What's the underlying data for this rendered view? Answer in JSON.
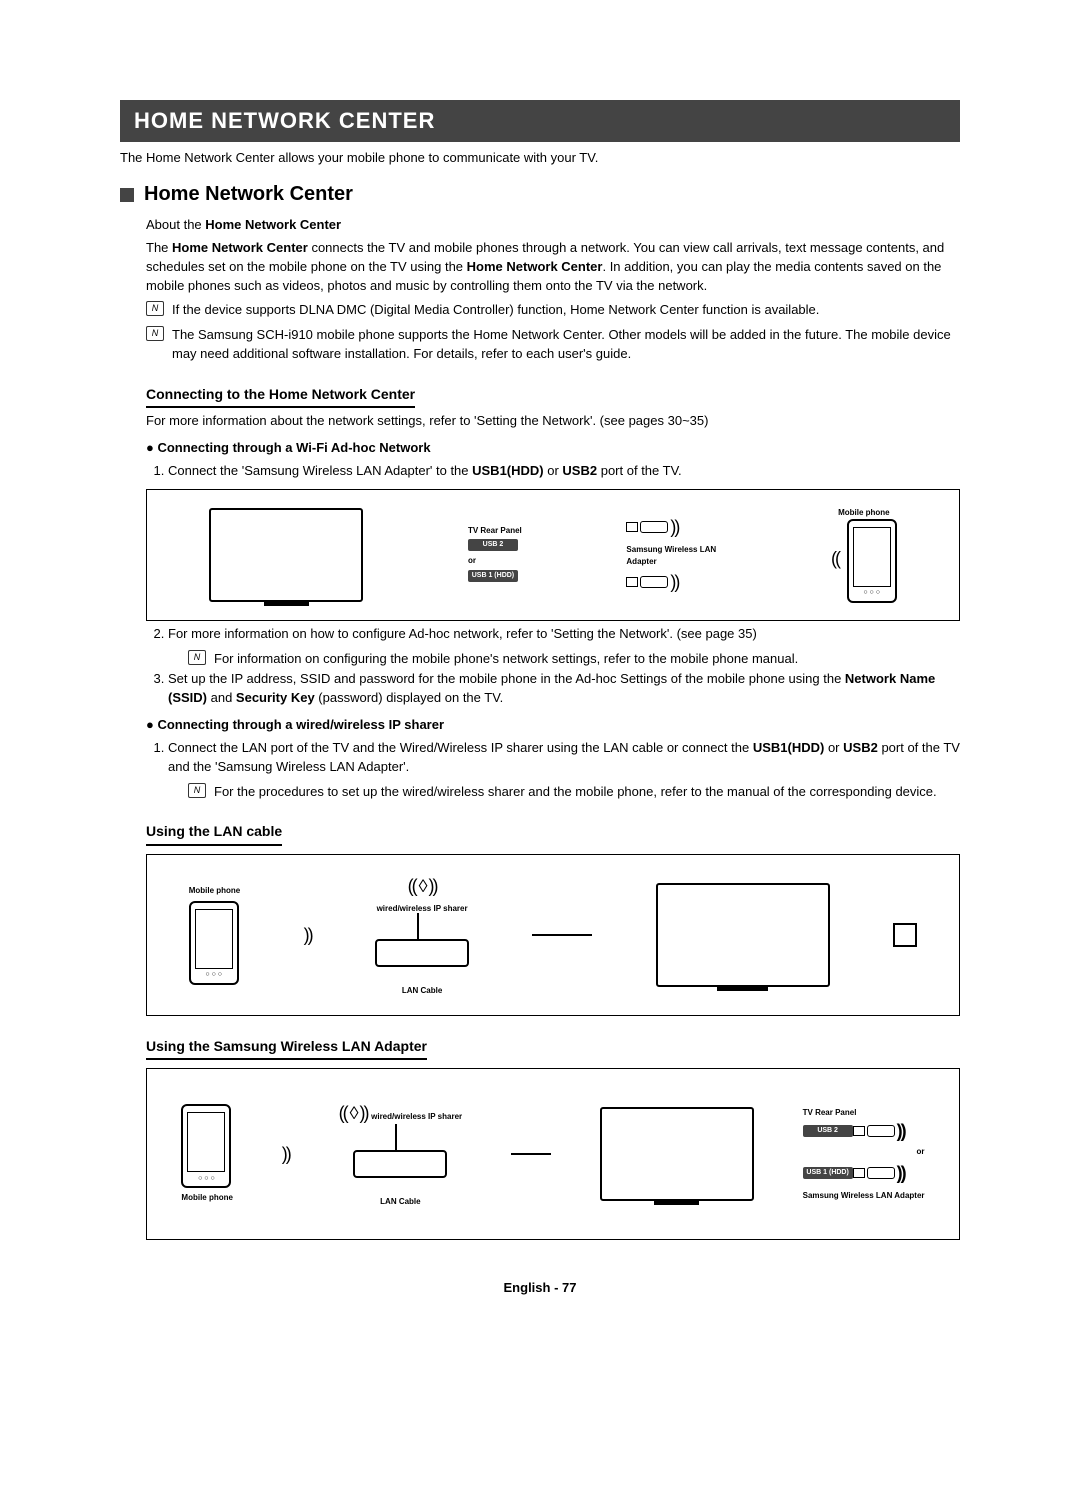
{
  "title_bar": "HOME NETWORK CENTER",
  "intro": "The Home Network Center allows your mobile phone to communicate with your TV.",
  "section1": {
    "heading": "Home Network Center",
    "about_prefix": "About the ",
    "about_bold": "Home Network Center",
    "description": "The Home Network Center connects the TV and mobile phones through a network. You can view call arrivals, text message contents, and schedules set on the mobile phone on the TV using the Home Network Center. In addition, you can play the media contents saved on the mobile phones such as videos, photos and music by controlling them onto the TV via the network.",
    "note1": "If the device supports DLNA DMC (Digital Media Controller) function, Home Network Center function is available.",
    "note2": "The Samsung SCH-i910 mobile phone supports the Home Network Center. Other models will be added in the future. The mobile device may need additional software installation. For details, refer to each user's guide."
  },
  "connecting": {
    "heading": "Connecting to the Home Network Center",
    "info": "For more information about the network settings, refer to 'Setting the Network'. (see pages 30~35)",
    "wifi_heading": "Connecting through a Wi-Fi Ad-hoc Network",
    "step1_prefix": "Connect the 'Samsung Wireless LAN Adapter' to the ",
    "step1_b1": "USB1(HDD)",
    "step1_mid": " or ",
    "step1_b2": "USB2",
    "step1_suffix": " port of the TV.",
    "step2": "For more information on how to configure Ad-hoc network, refer to 'Setting the Network'. (see page 35)",
    "step2_note": "For information on configuring the mobile phone's network settings, refer to the mobile phone manual.",
    "step3_prefix": "Set up the IP address, SSID and password for the mobile phone in the Ad-hoc Settings of the mobile phone using the ",
    "step3_b1": "Network Name (SSID)",
    "step3_mid": " and ",
    "step3_b2": "Security Key",
    "step3_suffix": " (password) displayed on the TV.",
    "wired_heading": "Connecting through a wired/wireless IP sharer",
    "wired_step1_prefix": "Connect the LAN port of the TV and the Wired/Wireless IP sharer using the LAN cable or connect the ",
    "wired_step1_b1": "USB1(HDD)",
    "wired_step1_mid": " or ",
    "wired_step1_b2": "USB2",
    "wired_step1_suffix": " port of the TV and the 'Samsung Wireless LAN Adapter'.",
    "wired_note": "For the procedures to set up the wired/wireless sharer and the mobile phone, refer to the manual of the corresponding device."
  },
  "lan_heading": "Using the LAN cable",
  "adapter_heading": "Using the Samsung Wireless LAN Adapter",
  "diagram_labels": {
    "tv_rear": "TV Rear Panel",
    "mobile": "Mobile phone",
    "usb2": "USB 2",
    "usb1": "USB 1 (HDD)",
    "or": "or",
    "swla": "Samsung Wireless LAN Adapter",
    "swla2": "Samsung Wireless LAN Adapter",
    "ip_sharer": "wired/wireless IP sharer",
    "lan_cable": "LAN Cable"
  },
  "footer": "English - 77"
}
